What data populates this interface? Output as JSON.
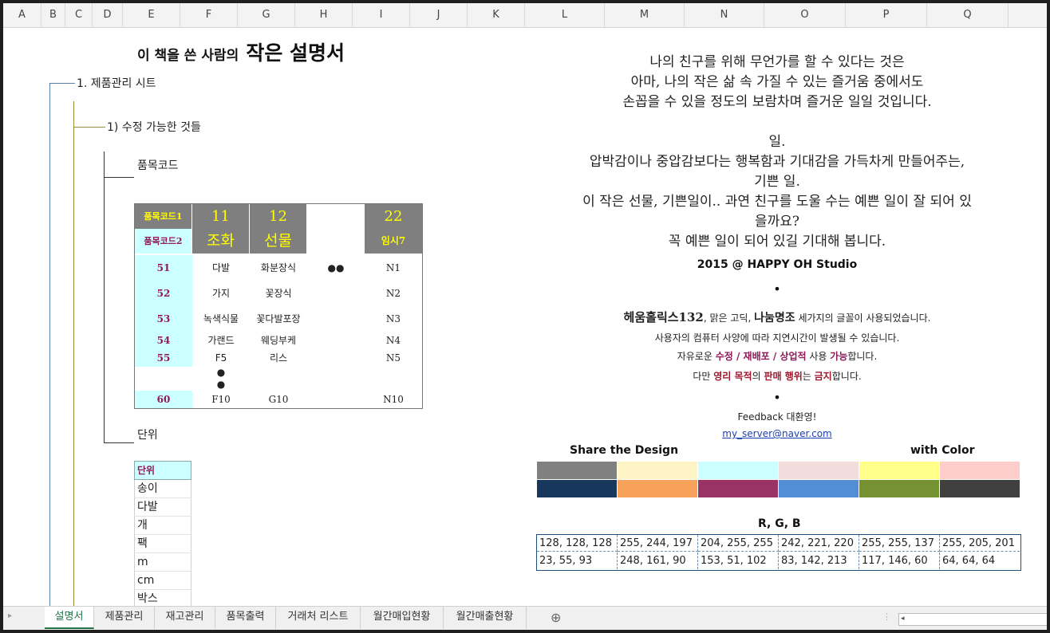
{
  "columns": [
    "A",
    "B",
    "C",
    "D",
    "E",
    "F",
    "G",
    "H",
    "I",
    "J",
    "K",
    "L",
    "M",
    "N",
    "O",
    "P",
    "Q"
  ],
  "left": {
    "title_small": "이 책을 쓴 사람의",
    "title_big": "작은 설명서",
    "sec1": "1. 제품관리 시트",
    "sec1_1": "1) 수정 가능한 것들",
    "item_code": "품목코드",
    "item_unit": "단위"
  },
  "code_table": {
    "header1": [
      "품목코드1",
      "11",
      "12",
      "",
      "22"
    ],
    "header2": [
      "품목코드2",
      "조화",
      "선물",
      "",
      "임시7"
    ],
    "rows": [
      [
        "51",
        "다발",
        "화분장식",
        "●●",
        "N1"
      ],
      [
        "52",
        "가지",
        "꽃장식",
        "",
        "N2"
      ],
      [
        "53",
        "녹색식물",
        "꽃다발포장",
        "",
        "N3"
      ],
      [
        "54",
        "가랜드",
        "웨딩부케",
        "",
        "N4"
      ],
      [
        "55",
        "F5",
        "리스",
        "",
        "N5"
      ]
    ],
    "dots": [
      "●",
      "●"
    ],
    "last_row": [
      "60",
      "F10",
      "G10",
      "",
      "N10"
    ]
  },
  "unit_list": {
    "header": "단위",
    "items": [
      "송이",
      "다발",
      "개",
      "팩",
      "m",
      "cm",
      "박스"
    ]
  },
  "right": {
    "poem1": [
      "나의 친구를 위해 무언가를 할 수 있다는 것은",
      "아마, 나의 작은 삶 속 가질 수 있는 즐거움 중에서도",
      "손꼽을 수 있을 정도의 보람차며 즐거운 일일 것입니다."
    ],
    "poem2": [
      "일.",
      "압박감이나 중압감보다는 행복함과 기대감을 가득차게 만들어주는,",
      "기쁜 일.",
      "이 작은 선물, 기쁜일이.. 과연 친구를 도울 수는 예쁜 일이 잘 되어 있",
      "을까요?",
      "꼭 예쁜 일이 되어 있길 기대해 봅니다."
    ],
    "studio": "2015 @ HAPPY OH Studio",
    "bullet": "•",
    "fonts_line": {
      "f1": "헤움홀릭스132",
      "sep1": ", 맑은 고딕, ",
      "f2": "나눔명조",
      "rest": " 세가지의 글꼴이 사용되었습니다."
    },
    "delay_line": "사용자의 컴퓨터 사양에 따라 지연시간이 발생될 수 있습니다.",
    "free_line": {
      "pre": "자유로운 ",
      "a": "수정",
      "s1": " / ",
      "b": "재배포",
      "s2": " / ",
      "c": "상업적",
      "mid": " 사용 ",
      "d": "가능",
      "post": "합니다."
    },
    "ban_line": {
      "pre": "다만 ",
      "a": "영리 목적",
      "m1": "의 ",
      "b": "판매 행위",
      "m2": "는 ",
      "c": "금지",
      "post": "합니다."
    },
    "feedback": "Feedback 대환영!",
    "email": "my_server@naver.com",
    "share": "Share the Design",
    "with_color": "with Color",
    "rgb_title": "R, G, B"
  },
  "palette": {
    "top": [
      "#808080",
      "#fff4c5",
      "#ccffff",
      "#f2ddd c",
      "#ffff89",
      "#ffcdc9"
    ],
    "bottom": [
      "#17375d",
      "#f8a15a",
      "#993366",
      "#538ed5",
      "#759232",
      "#404040"
    ]
  },
  "rgb": {
    "row1": [
      "128, 128, 128",
      "255, 244, 197",
      "204, 255, 255",
      "242, 221, 220",
      "255, 255, 137",
      "255, 205, 201"
    ],
    "row2": [
      "23, 55, 93",
      "248, 161, 90",
      "153, 51, 102",
      "83, 142, 213",
      "117, 146, 60",
      "64, 64, 64"
    ]
  },
  "tabs": [
    "설명서",
    "제품관리",
    "재고관리",
    "품목출력",
    "거래처 리스트",
    "월간매입현황",
    "월간매출현황"
  ],
  "add_sheet": "⊕"
}
